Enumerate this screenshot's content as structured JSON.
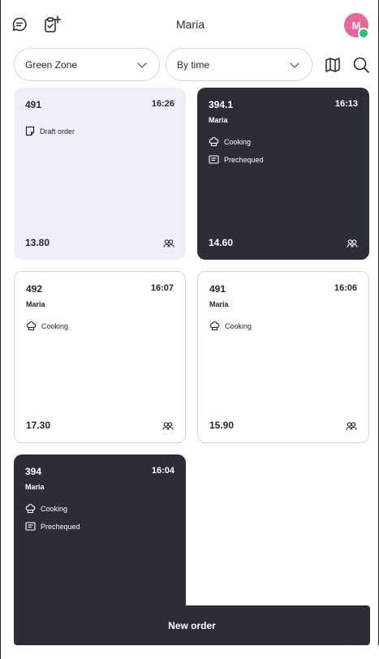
{
  "header": {
    "title": "Maria",
    "avatar_initial": "M",
    "avatar_color": "#e8669a",
    "status_color": "#2fbf71",
    "icons": [
      "chat-icon",
      "clipboard-add-icon"
    ]
  },
  "filters": {
    "zone": "Green Zone",
    "sort": "By time",
    "tools": [
      "map-icon",
      "search-icon"
    ]
  },
  "orders": [
    {
      "number": "491",
      "time": "16:26",
      "waiter": "",
      "statuses": [
        "Draft order"
      ],
      "total": "13.80",
      "style": "light"
    },
    {
      "number": "394.1",
      "time": "16:13",
      "waiter": "Maria",
      "statuses": [
        "Cooking",
        "Prechequed"
      ],
      "total": "14.60",
      "style": "dark"
    },
    {
      "number": "492",
      "time": "16:07",
      "waiter": "Maria",
      "statuses": [
        "Cooking"
      ],
      "total": "17.30",
      "style": "white"
    },
    {
      "number": "491",
      "time": "16:06",
      "waiter": "Maria",
      "statuses": [
        "Cooking"
      ],
      "total": "15.90",
      "style": "white"
    },
    {
      "number": "394",
      "time": "16:04",
      "waiter": "Maria",
      "statuses": [
        "Cooking",
        "Prechequed"
      ],
      "total": "",
      "style": "dark"
    }
  ],
  "actions": {
    "new_order": "New order"
  },
  "colors": {
    "dark_card": "#2b2e37",
    "light_card": "#eeeff9"
  }
}
